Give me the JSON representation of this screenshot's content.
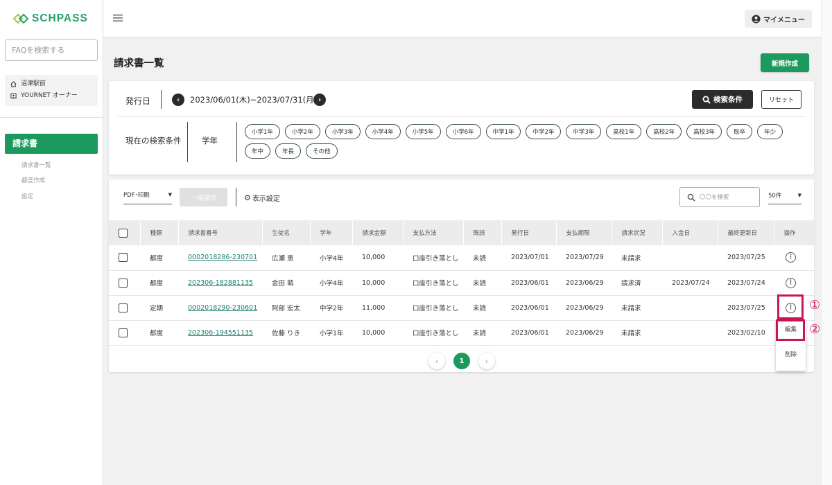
{
  "app": {
    "logo_text": "SCHPASS"
  },
  "sidebar": {
    "faq_placeholder": "FAQを検索する",
    "school_name": "沼津駅前",
    "owner_name": "YOURNET オーナー",
    "active_item": "請求書",
    "sub_items": [
      "請求書一覧",
      "都度作成",
      "設定"
    ]
  },
  "header": {
    "my_menu": "マイメニュー"
  },
  "page": {
    "title": "請求書一覧",
    "new_button": "新規作成"
  },
  "search": {
    "date_label": "発行日",
    "date_range": "2023/06/01(木)~2023/07/31(月)",
    "search_button": "検索条件",
    "reset_button": "リセット",
    "current_label": "現在の検索条件",
    "grade_label": "学年",
    "chips": [
      "小学1年",
      "小学2年",
      "小学3年",
      "小学4年",
      "小学5年",
      "小学6年",
      "中学1年",
      "中学2年",
      "中学3年",
      "高校1年",
      "高校2年",
      "高校3年",
      "既卒",
      "年少",
      "年中",
      "年長",
      "その他"
    ]
  },
  "toolbar": {
    "pdf_select": "PDF･印刷",
    "bulk_button": "一括操作",
    "display_settings": "表示設定",
    "search_placeholder": "〇〇を検索",
    "per_page": "50件"
  },
  "table": {
    "columns": [
      "種類",
      "請求書番号",
      "生徒名",
      "学年",
      "請求金額",
      "支払方法",
      "既読",
      "発行日",
      "支払期限",
      "請求状況",
      "入金日",
      "最終更新日",
      "操作"
    ],
    "rows": [
      [
        "都度",
        "0002018286-230701",
        "広瀬 恵",
        "小学4年",
        "10,000",
        "口座引き落とし",
        "未読",
        "2023/07/01",
        "2023/07/29",
        "未請求",
        "",
        "2023/07/25"
      ],
      [
        "都度",
        "202306-182881135",
        "金田 萌",
        "小学4年",
        "10,000",
        "口座引き落とし",
        "未読",
        "2023/06/01",
        "2023/06/29",
        "請求済",
        "2023/07/24",
        "2023/07/24"
      ],
      [
        "定期",
        "0002018290-230601",
        "阿部 宏太",
        "中学2年",
        "11,000",
        "口座引き落とし",
        "未読",
        "2023/06/01",
        "2023/06/29",
        "未請求",
        "",
        "2023/07/25"
      ],
      [
        "都度",
        "202306-194551135",
        "佐藤 りき",
        "小学1年",
        "10,000",
        "口座引き落とし",
        "未読",
        "2023/06/01",
        "2023/06/29",
        "未請求",
        "",
        "2023/02/10"
      ]
    ]
  },
  "pagination": {
    "current": "1"
  },
  "row_menu": {
    "edit": "編集",
    "delete": "削除"
  },
  "annotations": {
    "marker1": "①",
    "marker2": "②"
  },
  "colors": {
    "brand": "#1c9a5e",
    "highlight": "#c8155c",
    "link": "#1a7f6e"
  }
}
